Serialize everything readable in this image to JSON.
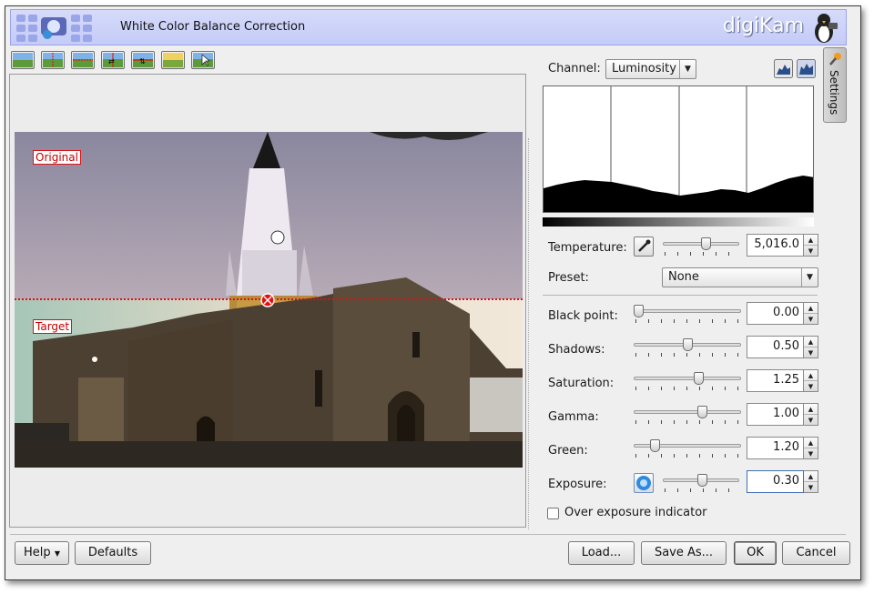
{
  "title": "White Color Balance Correction",
  "logo": "digiKam",
  "side_tab": "Settings",
  "image_labels": {
    "original": "Original",
    "target": "Target"
  },
  "channel": {
    "label": "Channel:",
    "value": "Luminosity"
  },
  "temperature": {
    "label": "Temperature:",
    "value": "5,016.0",
    "slider_fraction": 0.58
  },
  "preset": {
    "label": "Preset:",
    "value": "None"
  },
  "controls": [
    {
      "label": "Black point:",
      "value": "0.00",
      "slider_fraction": 0.0
    },
    {
      "label": "Shadows:",
      "value": "0.50",
      "slider_fraction": 0.5
    },
    {
      "label": "Saturation:",
      "value": "1.25",
      "slider_fraction": 0.62
    },
    {
      "label": "Gamma:",
      "value": "1.00",
      "slider_fraction": 0.65
    },
    {
      "label": "Green:",
      "value": "1.20",
      "slider_fraction": 0.17
    },
    {
      "label": "Exposure:",
      "value": "0.30",
      "slider_fraction": 0.52
    }
  ],
  "over_exposure": {
    "label": "Over exposure indicator",
    "checked": false
  },
  "buttons": {
    "help": "Help",
    "defaults": "Defaults",
    "load": "Load...",
    "save_as": "Save As...",
    "ok": "OK",
    "cancel": "Cancel"
  },
  "colors": {
    "banner": "#c4cbf7",
    "label_red": "#c40000",
    "split_line": "#e01010"
  }
}
